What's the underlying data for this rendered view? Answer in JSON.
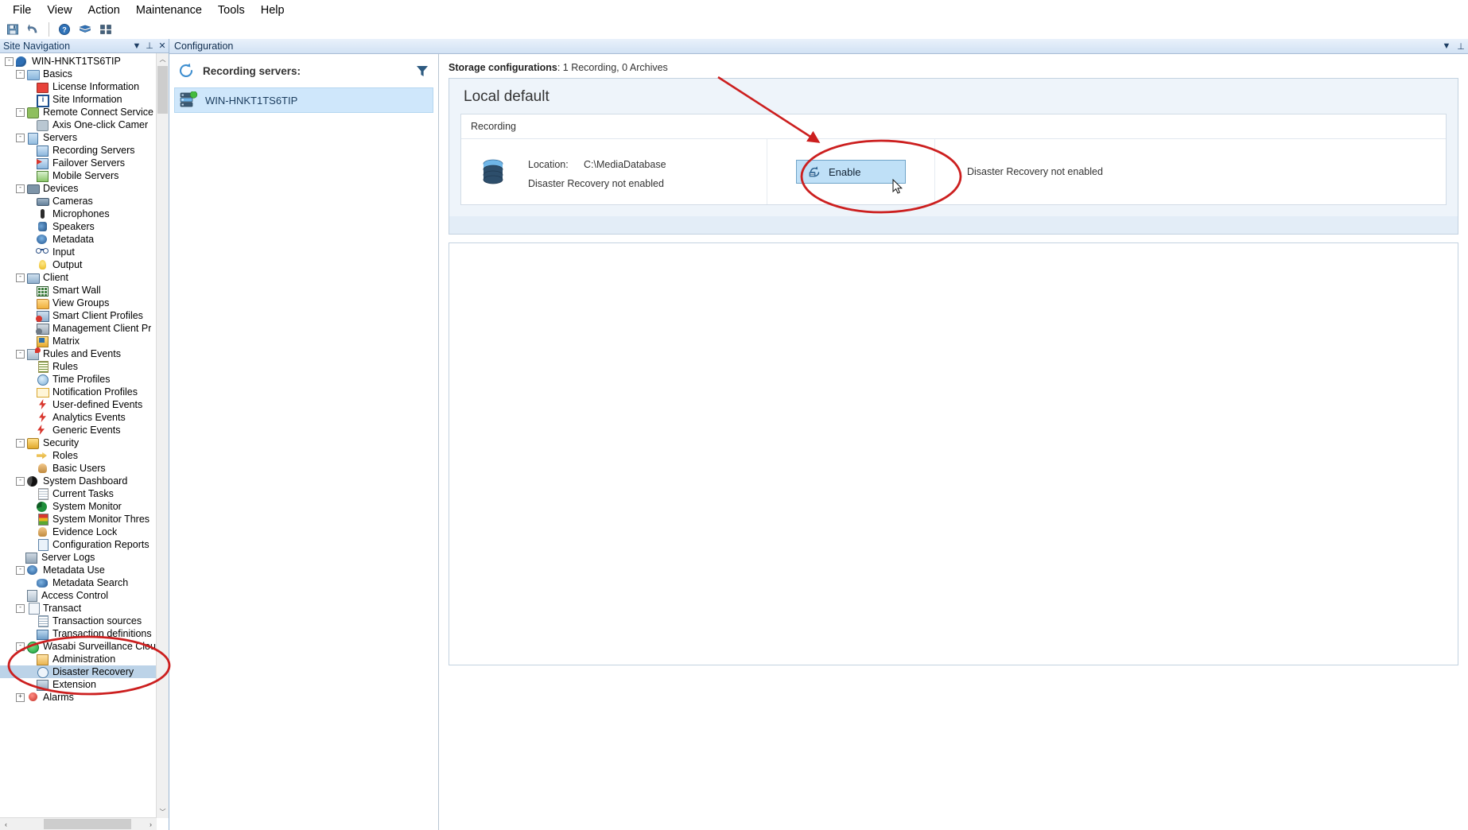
{
  "menubar": {
    "items": [
      "File",
      "View",
      "Action",
      "Maintenance",
      "Tools",
      "Help"
    ]
  },
  "toolbar": {
    "buttons": [
      {
        "name": "save-icon",
        "glyph": "save"
      },
      {
        "name": "undo-icon",
        "glyph": "undo"
      },
      {
        "name": "help-icon",
        "glyph": "help"
      },
      {
        "name": "book-icon",
        "glyph": "book"
      },
      {
        "name": "grid-icon",
        "glyph": "grid"
      }
    ]
  },
  "sidebar": {
    "title": "Site Navigation",
    "dropdown_label": "▼",
    "pin_label": "⊥",
    "close_label": "✕",
    "scroll_up": "︿",
    "scroll_down": "﹀",
    "scroll_left": "‹",
    "scroll_right": "›",
    "items": [
      {
        "label": "WIN-HNKT1TS6TIP",
        "indent": 0,
        "expander": "-",
        "icon": "i-site",
        "name": "site-root"
      },
      {
        "label": "Basics",
        "indent": 1,
        "expander": "-",
        "icon": "i-book",
        "name": "basics"
      },
      {
        "label": "License Information",
        "indent": 2,
        "expander": "",
        "icon": "i-lic",
        "name": "license-information"
      },
      {
        "label": "Site Information",
        "indent": 2,
        "expander": "",
        "icon": "i-info",
        "name": "site-information"
      },
      {
        "label": "Remote Connect Service",
        "indent": 1,
        "expander": "-",
        "icon": "i-rcs",
        "name": "remote-connect-service"
      },
      {
        "label": "Axis One-click Camer",
        "indent": 2,
        "expander": "",
        "icon": "i-axis",
        "name": "axis-one-click-camera"
      },
      {
        "label": "Servers",
        "indent": 1,
        "expander": "-",
        "icon": "i-srv",
        "name": "servers"
      },
      {
        "label": "Recording Servers",
        "indent": 2,
        "expander": "",
        "icon": "i-rsrv",
        "name": "recording-servers"
      },
      {
        "label": "Failover Servers",
        "indent": 2,
        "expander": "",
        "icon": "i-fsrv",
        "name": "failover-servers"
      },
      {
        "label": "Mobile Servers",
        "indent": 2,
        "expander": "",
        "icon": "i-msrv",
        "name": "mobile-servers"
      },
      {
        "label": "Devices",
        "indent": 1,
        "expander": "-",
        "icon": "i-dev",
        "name": "devices"
      },
      {
        "label": "Cameras",
        "indent": 2,
        "expander": "",
        "icon": "i-cam",
        "name": "cameras"
      },
      {
        "label": "Microphones",
        "indent": 2,
        "expander": "",
        "icon": "i-mic",
        "name": "microphones"
      },
      {
        "label": "Speakers",
        "indent": 2,
        "expander": "",
        "icon": "i-spk",
        "name": "speakers"
      },
      {
        "label": "Metadata",
        "indent": 2,
        "expander": "",
        "icon": "i-meta",
        "name": "metadata"
      },
      {
        "label": "Input",
        "indent": 2,
        "expander": "",
        "icon": "i-in",
        "name": "input"
      },
      {
        "label": "Output",
        "indent": 2,
        "expander": "",
        "icon": "i-out",
        "name": "output"
      },
      {
        "label": "Client",
        "indent": 1,
        "expander": "-",
        "icon": "i-client",
        "name": "client"
      },
      {
        "label": "Smart Wall",
        "indent": 2,
        "expander": "",
        "icon": "i-wall",
        "name": "smart-wall"
      },
      {
        "label": "View Groups",
        "indent": 2,
        "expander": "",
        "icon": "i-vg",
        "name": "view-groups"
      },
      {
        "label": "Smart Client Profiles",
        "indent": 2,
        "expander": "",
        "icon": "i-scp",
        "name": "smart-client-profiles"
      },
      {
        "label": "Management Client Pr",
        "indent": 2,
        "expander": "",
        "icon": "i-mcp",
        "name": "management-client-profiles"
      },
      {
        "label": "Matrix",
        "indent": 2,
        "expander": "",
        "icon": "i-matrix",
        "name": "matrix"
      },
      {
        "label": "Rules and Events",
        "indent": 1,
        "expander": "-",
        "icon": "i-re",
        "name": "rules-and-events"
      },
      {
        "label": "Rules",
        "indent": 2,
        "expander": "",
        "icon": "i-rules",
        "name": "rules"
      },
      {
        "label": "Time Profiles",
        "indent": 2,
        "expander": "",
        "icon": "i-time",
        "name": "time-profiles"
      },
      {
        "label": "Notification Profiles",
        "indent": 2,
        "expander": "",
        "icon": "i-notif",
        "name": "notification-profiles"
      },
      {
        "label": "User-defined Events",
        "indent": 2,
        "expander": "",
        "icon": "i-ude",
        "name": "user-defined-events"
      },
      {
        "label": "Analytics Events",
        "indent": 2,
        "expander": "",
        "icon": "i-ae",
        "name": "analytics-events"
      },
      {
        "label": "Generic Events",
        "indent": 2,
        "expander": "",
        "icon": "i-ge",
        "name": "generic-events"
      },
      {
        "label": "Security",
        "indent": 1,
        "expander": "-",
        "icon": "i-sec",
        "name": "security"
      },
      {
        "label": "Roles",
        "indent": 2,
        "expander": "",
        "icon": "i-roles",
        "name": "roles"
      },
      {
        "label": "Basic Users",
        "indent": 2,
        "expander": "",
        "icon": "i-user",
        "name": "basic-users"
      },
      {
        "label": "System Dashboard",
        "indent": 1,
        "expander": "-",
        "icon": "i-dash",
        "name": "system-dashboard"
      },
      {
        "label": "Current Tasks",
        "indent": 2,
        "expander": "",
        "icon": "i-task",
        "name": "current-tasks"
      },
      {
        "label": "System Monitor",
        "indent": 2,
        "expander": "",
        "icon": "i-sysmon",
        "name": "system-monitor"
      },
      {
        "label": "System Monitor Thres",
        "indent": 2,
        "expander": "",
        "icon": "i-thres",
        "name": "system-monitor-thresholds"
      },
      {
        "label": "Evidence Lock",
        "indent": 2,
        "expander": "",
        "icon": "i-evl",
        "name": "evidence-lock"
      },
      {
        "label": "Configuration Reports",
        "indent": 2,
        "expander": "",
        "icon": "i-cfgr",
        "name": "configuration-reports"
      },
      {
        "label": "Server Logs",
        "indent": 1,
        "expander": "",
        "icon": "i-slog",
        "name": "server-logs"
      },
      {
        "label": "Metadata Use",
        "indent": 1,
        "expander": "-",
        "icon": "i-mdu",
        "name": "metadata-use"
      },
      {
        "label": "Metadata Search",
        "indent": 2,
        "expander": "",
        "icon": "i-mds",
        "name": "metadata-search"
      },
      {
        "label": "Access Control",
        "indent": 1,
        "expander": "",
        "icon": "i-ac",
        "name": "access-control"
      },
      {
        "label": "Transact",
        "indent": 1,
        "expander": "-",
        "icon": "i-tr",
        "name": "transact"
      },
      {
        "label": "Transaction sources",
        "indent": 2,
        "expander": "",
        "icon": "i-trs",
        "name": "transaction-sources"
      },
      {
        "label": "Transaction definitions",
        "indent": 2,
        "expander": "",
        "icon": "i-trd",
        "name": "transaction-definitions"
      },
      {
        "label": "Wasabi Surveillance Clou",
        "indent": 1,
        "expander": "-",
        "icon": "i-wasabi",
        "name": "wasabi-surveillance-cloud"
      },
      {
        "label": "Administration",
        "indent": 2,
        "expander": "",
        "icon": "i-admin",
        "name": "administration"
      },
      {
        "label": "Disaster Recovery",
        "indent": 2,
        "expander": "",
        "icon": "i-dr",
        "name": "disaster-recovery",
        "selected": true
      },
      {
        "label": "Extension",
        "indent": 2,
        "expander": "",
        "icon": "i-ext",
        "name": "extension"
      },
      {
        "label": "Alarms",
        "indent": 1,
        "expander": "+",
        "icon": "i-alarm",
        "name": "alarms"
      }
    ]
  },
  "configuration": {
    "tab_label": "Configuration",
    "dropdown_label": "▼",
    "pin_label": "⊥"
  },
  "recording_servers": {
    "title": "Recording servers:",
    "refresh_icon": "refresh-icon",
    "filter_icon": "filter-icon",
    "servers": [
      {
        "name": "WIN-HNKT1TS6TIP",
        "status": "online"
      }
    ]
  },
  "storage": {
    "summary_label": "Storage configurations",
    "summary_value": "1 Recording, 0 Archives",
    "card_title": "Local default",
    "section_label": "Recording",
    "location_key": "Location:",
    "location_value": "C:\\MediaDatabase",
    "status_text": "Disaster Recovery not enabled",
    "enable_button": "Enable",
    "right_status_text": "Disaster Recovery not enabled"
  },
  "annotations": {
    "arrow_color": "#cc1f1f",
    "ellipse_color": "#cc1f1f"
  },
  "colors": {
    "selection_blue": "#bcd3e8",
    "panel_blue": "#cfe7fb",
    "button_blue": "#bfe0f7",
    "header_gradient_top": "#e4eefb",
    "header_gradient_bottom": "#cfe0f3"
  }
}
